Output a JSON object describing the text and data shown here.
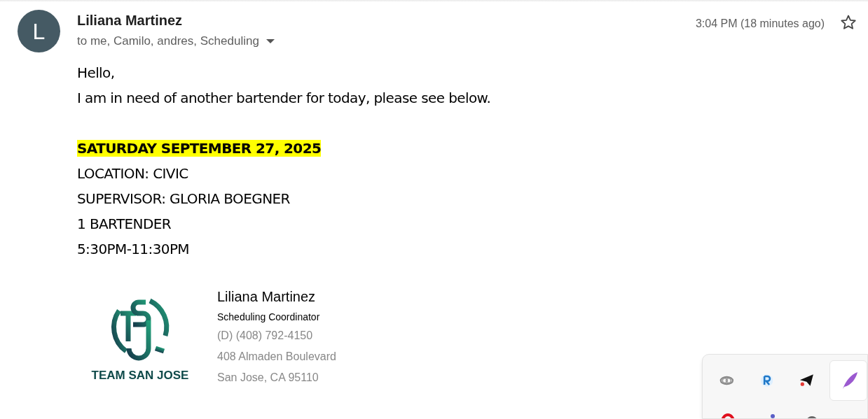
{
  "message": {
    "avatar_letter": "L",
    "sender": "Liliana Martinez",
    "recipients": "to me, Camilo, andres, Scheduling",
    "time": "3:04 PM (18 minutes ago)",
    "starred": false
  },
  "body": {
    "intro": [
      {
        "text": "Hello,",
        "highlighted": false
      },
      {
        "text": "I am in need of another bartender for today, please see below.",
        "highlighted": false
      }
    ],
    "details": [
      {
        "text": "SATURDAY SEPTEMBER 27, 2025",
        "highlighted": true,
        "bold": true
      },
      {
        "text": "LOCATION: CIVIC",
        "highlighted": false,
        "bold": false
      },
      {
        "text": "SUPERVISOR: GLORIA BOEGNER",
        "highlighted": false,
        "bold": false
      },
      {
        "text": "1 BARTENDER",
        "highlighted": false,
        "bold": false
      },
      {
        "text": "5:30PM-11:30PM",
        "highlighted": false,
        "bold": false
      }
    ]
  },
  "signature": {
    "logo_text": "TEAM SAN JOSE",
    "name": "Liliana Martinez",
    "title": "Scheduling Coordinator",
    "contact": [
      "(D) (408) 792-4150",
      "408 Almaden Boulevard",
      "San Jose, CA 95110"
    ]
  }
}
